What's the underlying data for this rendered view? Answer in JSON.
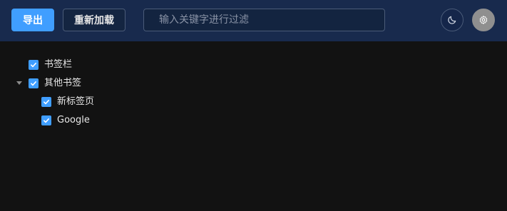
{
  "toolbar": {
    "export_label": "导出",
    "reload_label": "重新加载",
    "search_placeholder": "输入关键字进行过滤",
    "theme_icon": "moon-icon",
    "settings_icon": "gear-icon"
  },
  "colors": {
    "header_bg": "#182a4d",
    "accent": "#409eff",
    "body_bg": "#121212"
  },
  "tree": {
    "items": [
      {
        "label": "书签栏",
        "checked": true,
        "level": 0,
        "expanded": false
      },
      {
        "label": "其他书签",
        "checked": true,
        "level": 0,
        "expanded": true
      },
      {
        "label": "新标签页",
        "checked": true,
        "level": 1
      },
      {
        "label": "Google",
        "checked": true,
        "level": 1
      }
    ]
  }
}
